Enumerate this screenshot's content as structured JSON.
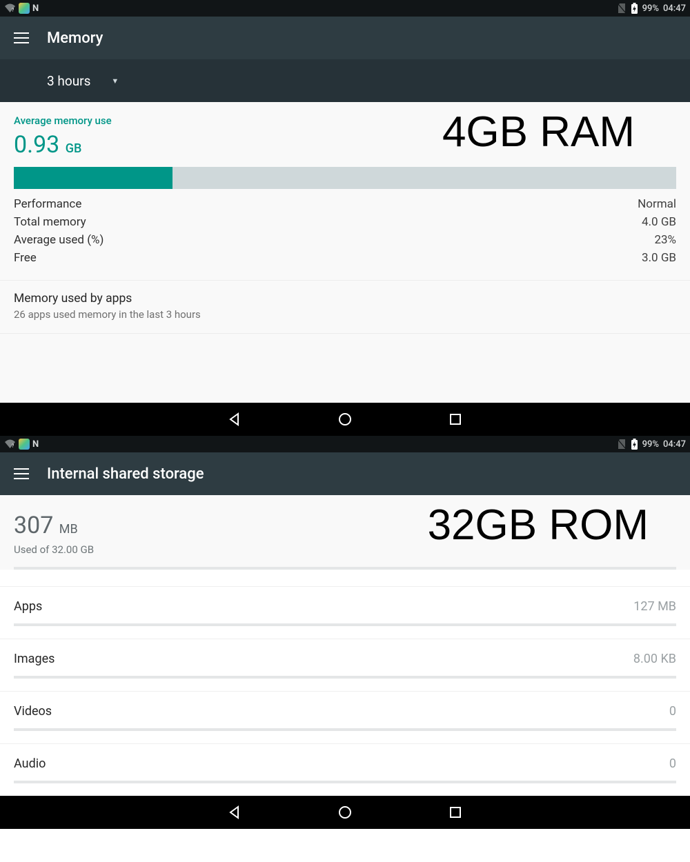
{
  "status": {
    "battery_pct": "99%",
    "time": "04:47",
    "n_letter": "N"
  },
  "memory": {
    "title": "Memory",
    "range": "3 hours",
    "amu_label": "Average memory use",
    "amu_value": "0.93",
    "amu_unit": "GB",
    "bar_fill_pct": 24,
    "annotation": "4GB RAM",
    "rows": [
      {
        "k": "Performance",
        "v": "Normal"
      },
      {
        "k": "Total memory",
        "v": "4.0 GB"
      },
      {
        "k": "Average used (%)",
        "v": "23%"
      },
      {
        "k": "Free",
        "v": "3.0 GB"
      }
    ],
    "apps_title": "Memory used by apps",
    "apps_sub": "26 apps used memory in the last 3 hours"
  },
  "storage": {
    "title": "Internal shared storage",
    "used_value": "307",
    "used_unit": "MB",
    "used_sub": "Used of 32.00 GB",
    "annotation": "32GB ROM",
    "categories": [
      {
        "name": "Apps",
        "size": "127 MB"
      },
      {
        "name": "Images",
        "size": "8.00 KB"
      },
      {
        "name": "Videos",
        "size": "0"
      },
      {
        "name": "Audio",
        "size": "0"
      }
    ]
  }
}
